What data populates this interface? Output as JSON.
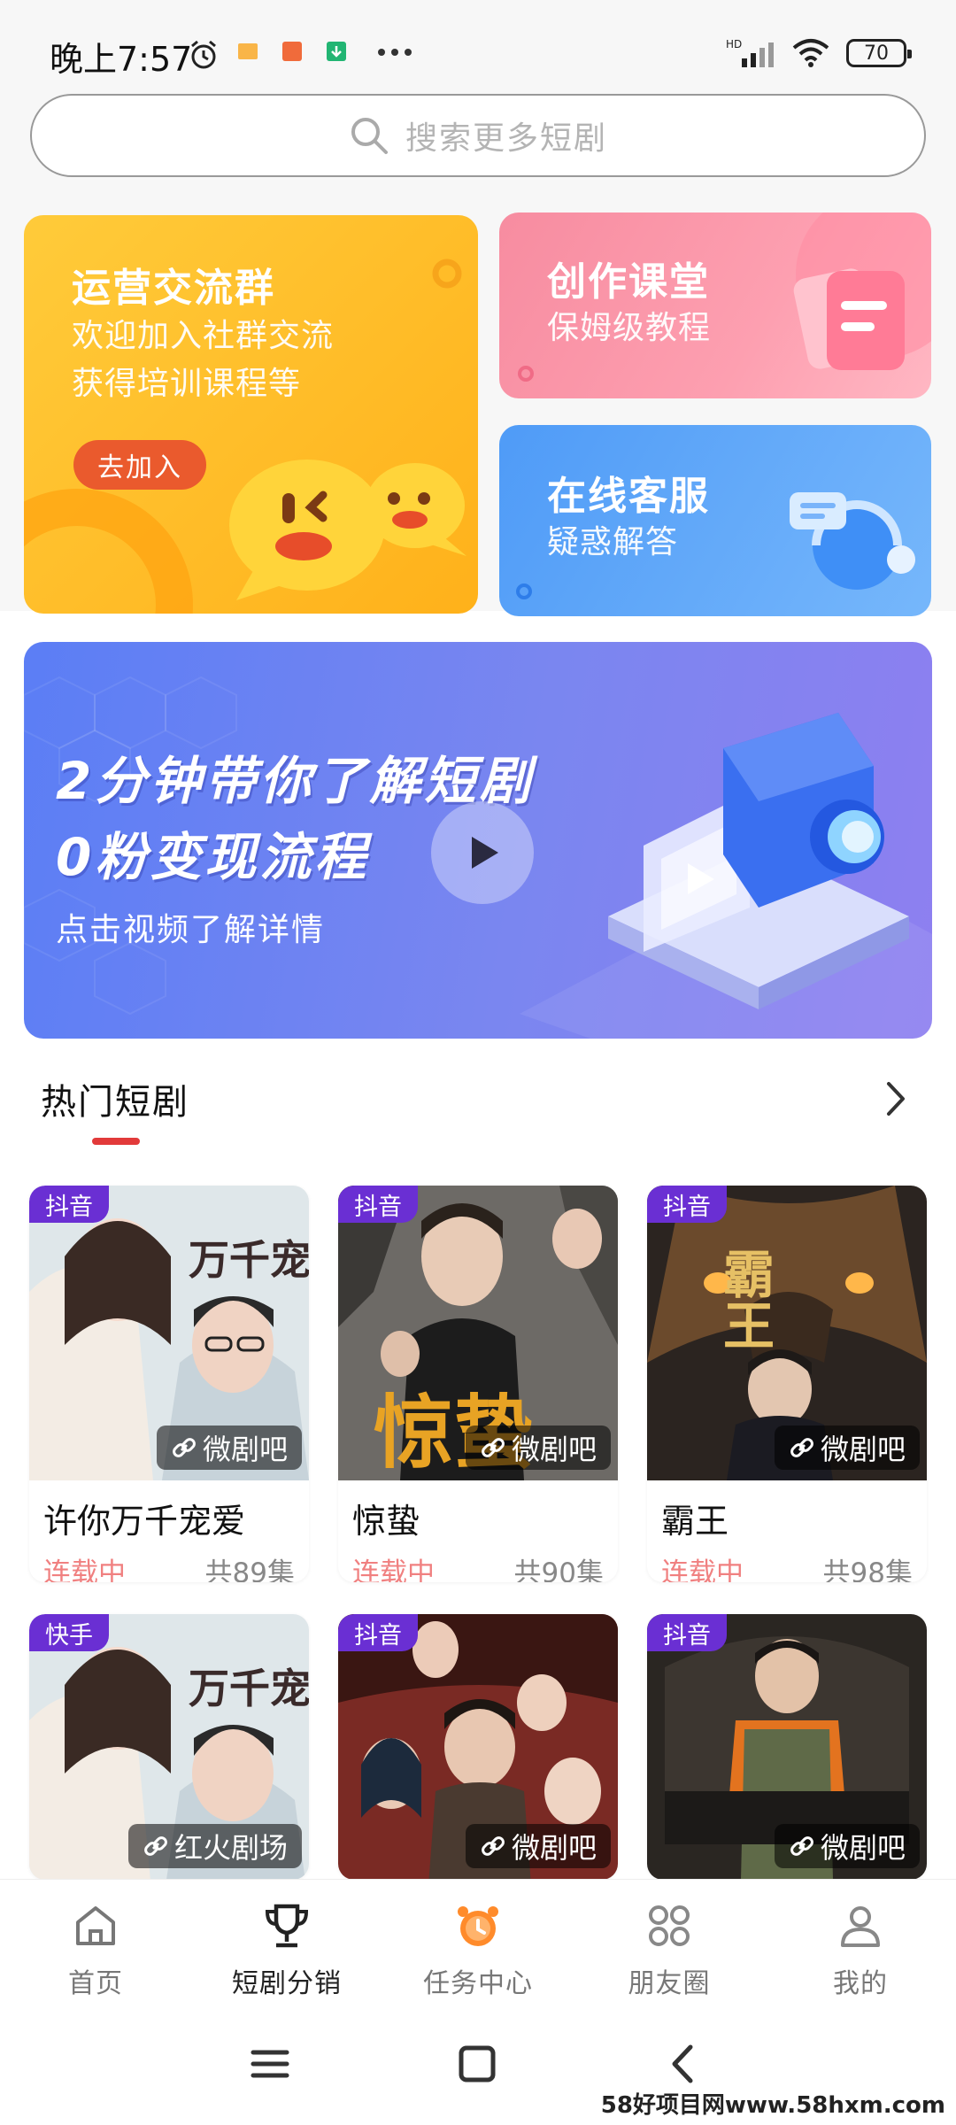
{
  "status_bar": {
    "time": "晚上7:57",
    "network": "HD",
    "battery": "70"
  },
  "search": {
    "placeholder": "搜索更多短剧"
  },
  "cards": {
    "group": {
      "title": "运营交流群",
      "line1": "欢迎加入社群交流",
      "line2": "获得培训课程等",
      "button": "去加入"
    },
    "course": {
      "title": "创作课堂",
      "subtitle": "保姆级教程"
    },
    "service": {
      "title": "在线客服",
      "subtitle": "疑惑解答"
    }
  },
  "banner": {
    "line1": "2分钟带你了解短剧",
    "line2": "0粉变现流程",
    "subtitle": "点击视频了解详情"
  },
  "section": {
    "title": "热门短剧"
  },
  "dramas": [
    {
      "platform": "抖音",
      "source": "微剧吧",
      "title": "许你万千宠爱",
      "status": "连载中",
      "episodes": "共89集"
    },
    {
      "platform": "抖音",
      "source": "微剧吧",
      "title": "惊蛰",
      "status": "连载中",
      "episodes": "共90集"
    },
    {
      "platform": "抖音",
      "source": "微剧吧",
      "title": "霸王",
      "status": "连载中",
      "episodes": "共98集"
    },
    {
      "platform": "快手",
      "source": "红火剧场"
    },
    {
      "platform": "抖音",
      "source": "微剧吧"
    },
    {
      "platform": "抖音",
      "source": "微剧吧"
    }
  ],
  "poster_text": {
    "p1": "万千宠爱",
    "p2": "惊蛰",
    "p3": "霸王"
  },
  "nav": [
    {
      "label": "首页"
    },
    {
      "label": "短剧分销"
    },
    {
      "label": "任务中心"
    },
    {
      "label": "朋友圈"
    },
    {
      "label": "我的"
    }
  ],
  "colors": {
    "accent_red": "#e23a3a",
    "platform_purple": "#6a2fd3",
    "status_pink": "#f08080"
  },
  "watermark": "58好项目网www.58hxm.com"
}
